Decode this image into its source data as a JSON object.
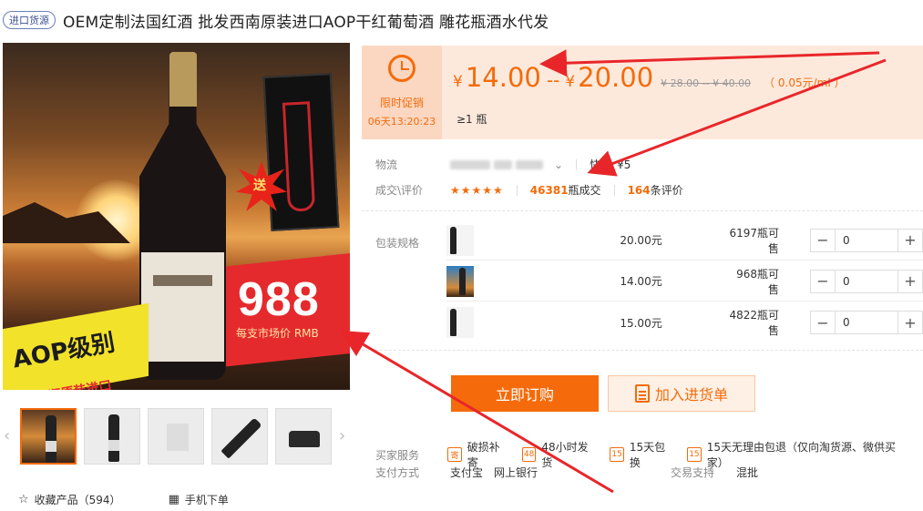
{
  "title": {
    "tag": "进口货源",
    "text": "OEM定制法国红酒 批发西南原装进口AOP干红葡萄酒 雕花瓶酒水代发"
  },
  "gallery": {
    "promo_badge": "送",
    "price_banner": "988",
    "price_banner_sub": "每支市场价 RMB",
    "aop_text": "AOP级别",
    "aop_sub": "法国原瓶原装进口",
    "thumbs_count": 5,
    "prev_icon": "chevron-left-icon",
    "next_icon": "chevron-right-icon"
  },
  "favorite": {
    "label": "收藏产品（594）"
  },
  "mobile_order": {
    "label": "手机下单"
  },
  "promo": {
    "label": "限时促销",
    "timer": "06天13:20:23"
  },
  "price": {
    "currency": "¥",
    "low": "14.00",
    "dash": "--",
    "high": "20.00",
    "old_range": "¥ 28.00 -- ¥ 40.00",
    "unit_price": "（ 0.05元/ml ）",
    "moq": "≥1 瓶"
  },
  "logistics": {
    "label": "物流",
    "carrier_label": "快递",
    "carrier_value": "¥5"
  },
  "deals": {
    "label": "成交\\评价",
    "stars": "★★★★★",
    "sold_count": "46381",
    "sold_suffix": "瓶成交",
    "review_count": "164",
    "review_suffix": "条评价"
  },
  "specs": {
    "label": "包装规格",
    "rows": [
      {
        "price": "20.00元",
        "stock": "6197",
        "stock_suffix": "瓶可售",
        "qty": "0"
      },
      {
        "price": "14.00元",
        "stock": "968",
        "stock_suffix": "瓶可售",
        "qty": "0"
      },
      {
        "price": "15.00元",
        "stock": "4822",
        "stock_suffix": "瓶可售",
        "qty": "0"
      }
    ],
    "minus": "−",
    "plus": "+"
  },
  "buttons": {
    "buy": "立即订购",
    "cart": "加入进货单"
  },
  "services": {
    "label": "买家服务",
    "items": [
      {
        "icon_text": "寄",
        "text": "破损补寄"
      },
      {
        "icon_text": "48",
        "text": "48小时发货"
      },
      {
        "icon_text": "15",
        "text": "15天包换"
      },
      {
        "icon_text": "15",
        "text": "15天无理由包退（仅向淘货源、微供买家）"
      }
    ]
  },
  "payment": {
    "label": "支付方式",
    "methods": [
      "支付宝",
      "网上银行"
    ],
    "trade_label": "交易支持",
    "trade_value": "混批"
  },
  "colors": {
    "accent": "#f46b0a",
    "price_bg": "#fde9dc",
    "annotation": "#e8262a"
  }
}
